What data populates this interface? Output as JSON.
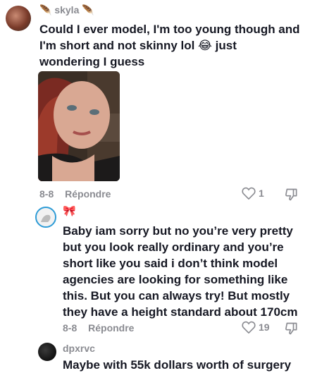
{
  "comments": [
    {
      "username": "skyla",
      "username_decor": "🪶",
      "text": "Could I ever model, I'm too young though and I'm short and not skinny lol 😂 just wondering I guess",
      "date": "8-8",
      "reply_label": "Répondre",
      "likes": "1"
    },
    {
      "username": "🎀",
      "text": "Baby iam sorry but no you’re very pretty but you look really ordinary and you’re short like you said i don’t think model agencies are looking for something like this. But you can always try! But mostly they have a height standard about 170cm",
      "date": "8-8",
      "reply_label": "Répondre",
      "likes": "19"
    },
    {
      "username": "dpxrvc",
      "text": "Maybe with 55k dollars worth of surgery"
    }
  ],
  "icons": {
    "like": "heart-outline-icon",
    "dislike": "thumbs-down-icon"
  },
  "colors": {
    "muted": "#8a8b91",
    "text": "#161823"
  }
}
